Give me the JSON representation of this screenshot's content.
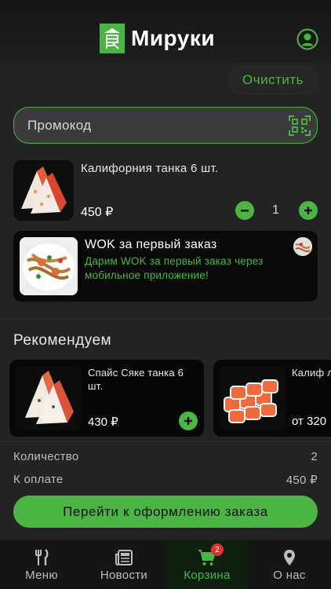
{
  "header": {
    "app_name": "Мируки"
  },
  "cart": {
    "clear_label": "Очистить",
    "promo_placeholder": "Промокод",
    "items": [
      {
        "name": "Калифорния танка 6 шт.",
        "price": "450 ₽",
        "quantity": "1"
      }
    ],
    "promo_banner": {
      "title": "WOK за первый заказ",
      "description": "Дарим WOK за первый заказ через мобильное приложение!"
    }
  },
  "recommended": {
    "title": "Рекомендуем",
    "items": [
      {
        "name": "Спайс Сяке танка 6 шт.",
        "price": "430 ₽"
      },
      {
        "name": "Калиф лососе",
        "price": "от 320"
      }
    ]
  },
  "summary": {
    "quantity_label": "Количество",
    "quantity_value": "2",
    "total_label": "К оплате",
    "total_value": "450 ₽"
  },
  "checkout_label": "Перейти к оформлению заказа",
  "tabs": [
    {
      "label": "Меню",
      "icon": "fork-knife-icon"
    },
    {
      "label": "Новости",
      "icon": "newspaper-icon"
    },
    {
      "label": "Корзина",
      "icon": "cart-icon",
      "badge": "2"
    },
    {
      "label": "О нас",
      "icon": "location-pin-icon"
    }
  ],
  "colors": {
    "accent": "#4bb543",
    "background": "#232323",
    "badge": "#e0312c"
  }
}
